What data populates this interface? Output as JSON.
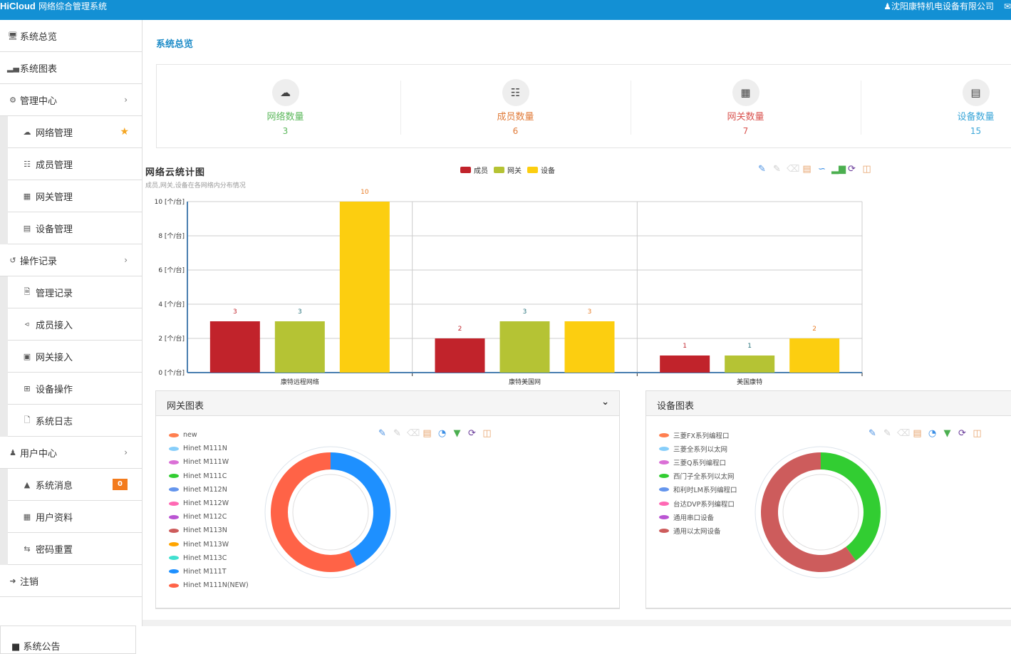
{
  "header": {
    "brand": "HiCloud",
    "app_title": "网络综合管理系统",
    "user_icon": "user-icon",
    "company": "沈阳康特机电设备有限公司",
    "mail_icon": "envelope-icon"
  },
  "sidebar": {
    "items": [
      {
        "label": "系统总览",
        "icon": "monitor-icon"
      },
      {
        "label": "系统图表",
        "icon": "bar-chart-icon"
      },
      {
        "label": "管理中心",
        "icon": "cogs-icon",
        "expandable": true,
        "children": [
          {
            "label": "网络管理",
            "icon": "cloud-icon",
            "starred": true
          },
          {
            "label": "成员管理",
            "icon": "sitemap-icon"
          },
          {
            "label": "网关管理",
            "icon": "grid-icon"
          },
          {
            "label": "设备管理",
            "icon": "calendar-icon"
          }
        ]
      },
      {
        "label": "操作记录",
        "icon": "history-icon",
        "expandable": true,
        "children": [
          {
            "label": "管理记录",
            "icon": "file-text-icon"
          },
          {
            "label": "成员接入",
            "icon": "share-icon"
          },
          {
            "label": "网关接入",
            "icon": "share-square-icon"
          },
          {
            "label": "设备操作",
            "icon": "plus-square-icon"
          },
          {
            "label": "系统日志",
            "icon": "file-icon"
          }
        ]
      },
      {
        "label": "用户中心",
        "icon": "users-icon",
        "expandable": true,
        "children": [
          {
            "label": "系统消息",
            "icon": "bell-icon",
            "badge": "0"
          },
          {
            "label": "用户资料",
            "icon": "th-large-icon"
          },
          {
            "label": "密码重置",
            "icon": "retweet-icon"
          }
        ]
      },
      {
        "label": "注销",
        "icon": "sign-out-icon"
      }
    ],
    "notice_label": "系统公告"
  },
  "main": {
    "page_title": "系统总览",
    "stats": [
      {
        "label": "网络数量",
        "value": "3",
        "icon": "cloud-icon",
        "color": "#5cb85c"
      },
      {
        "label": "成员数量",
        "value": "6",
        "icon": "sitemap-icon",
        "color": "#e07b39"
      },
      {
        "label": "网关数量",
        "value": "7",
        "icon": "grid-icon",
        "color": "#d9534f"
      },
      {
        "label": "设备数量",
        "value": "15",
        "icon": "calendar-icon",
        "color": "#3ba6d8"
      }
    ],
    "toolbox_bar": [
      "pencil-plus-icon",
      "pencil-icon",
      "eraser-icon",
      "data-view-icon",
      "line-chart-icon",
      "bar-chart-icon",
      "refresh-icon",
      "save-icon"
    ],
    "toolbox_pie": [
      "pencil-plus-icon",
      "pencil-icon",
      "eraser-icon",
      "data-view-icon",
      "pie-chart-icon",
      "funnel-icon",
      "refresh-icon",
      "save-icon"
    ],
    "gateway_panel_title": "网关图表",
    "device_panel_title": "设备图表"
  },
  "chart_data": [
    {
      "type": "bar",
      "title": "网络云统计图",
      "subtitle": "成员,网关,设备在各网络内分布情况",
      "categories": [
        "康特远程网络",
        "康特美国网",
        "美国康特"
      ],
      "series": [
        {
          "name": "成员",
          "color": "#c1232b",
          "values": [
            3,
            2,
            1
          ]
        },
        {
          "name": "网关",
          "color": "#b5c334",
          "values": [
            3,
            3,
            1
          ]
        },
        {
          "name": "设备",
          "color": "#fcce10",
          "values": [
            10,
            3,
            2
          ]
        }
      ],
      "ylim": [
        0,
        10
      ],
      "yticks": [
        "0 [个/台]",
        "2 [个/台]",
        "4 [个/台]",
        "6 [个/台]",
        "8 [个/台]",
        "10 [个/台]"
      ],
      "ytick_values": [
        0,
        2,
        4,
        6,
        8,
        10
      ],
      "grid": true,
      "legend": "top-center",
      "data_labels": true
    },
    {
      "type": "pie",
      "title": "网关图表",
      "donut": true,
      "legend": "left",
      "legend_entries": [
        {
          "name": "new",
          "color": "#ff7f50"
        },
        {
          "name": "Hinet M111N",
          "color": "#87cefa"
        },
        {
          "name": "Hinet M111W",
          "color": "#da70d6"
        },
        {
          "name": "Hinet M111C",
          "color": "#32cd32"
        },
        {
          "name": "Hinet M112N",
          "color": "#6495ed"
        },
        {
          "name": "Hinet M112W",
          "color": "#ff69b4"
        },
        {
          "name": "Hinet M112C",
          "color": "#ba55d3"
        },
        {
          "name": "Hinet M113N",
          "color": "#cd5c5c"
        },
        {
          "name": "Hinet M113W",
          "color": "#ffa500"
        },
        {
          "name": "Hinet M113C",
          "color": "#40e0d0"
        },
        {
          "name": "Hinet M111T",
          "color": "#1e90ff"
        },
        {
          "name": "Hinet M111N(NEW)",
          "color": "#ff6347"
        }
      ],
      "slices": [
        {
          "name": "Hinet M111T",
          "value": 3,
          "color": "#1e90ff"
        },
        {
          "name": "Hinet M111N(NEW)",
          "value": 4,
          "color": "#ff6347"
        }
      ]
    },
    {
      "type": "pie",
      "title": "设备图表",
      "donut": true,
      "legend": "left",
      "legend_entries": [
        {
          "name": "三菱FX系列编程口",
          "color": "#ff7f50"
        },
        {
          "name": "三菱全系列以太网",
          "color": "#87cefa"
        },
        {
          "name": "三菱Q系列编程口",
          "color": "#da70d6"
        },
        {
          "name": "西门子全系列以太网",
          "color": "#32cd32"
        },
        {
          "name": "和利时LM系列编程口",
          "color": "#6495ed"
        },
        {
          "name": "台达DVP系列编程口",
          "color": "#ff69b4"
        },
        {
          "name": "通用串口设备",
          "color": "#ba55d3"
        },
        {
          "name": "通用以太网设备",
          "color": "#cd5c5c"
        }
      ],
      "slices": [
        {
          "name": "西门子全系列以太网",
          "value": 6,
          "color": "#32cd32"
        },
        {
          "name": "通用以太网设备",
          "value": 9,
          "color": "#cd5c5c"
        }
      ]
    }
  ]
}
